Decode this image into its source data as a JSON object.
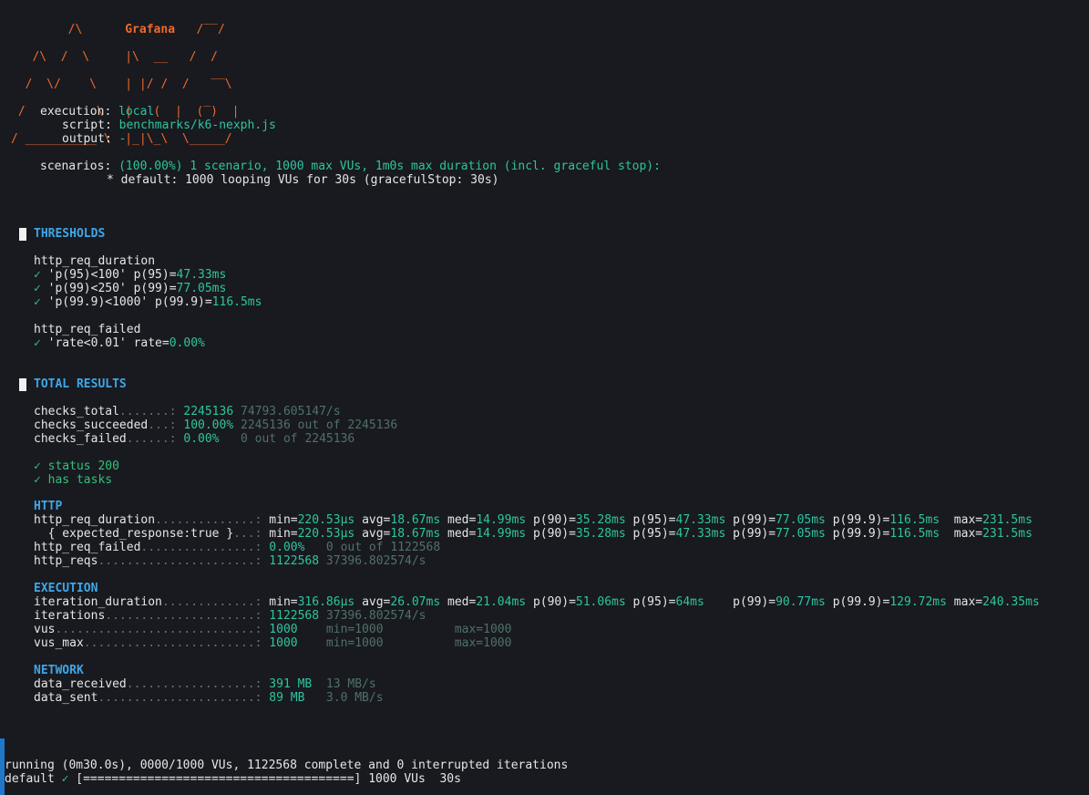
{
  "logo": {
    "art": [
      "        /\\      Grafana   /‾‾/",
      "   /\\  /  \\     |\\  __   /  /",
      "  /  \\/    \\    | |/ /  /   ‾‾\\",
      " /          \\   |   (  |  (‾)  |",
      "/ __________ \\  |_|\\_\\  \\_____/"
    ],
    "brand": "Grafana"
  },
  "info": {
    "execution": {
      "label": "execution:",
      "value": "local"
    },
    "script": {
      "label": "script:",
      "value": "benchmarks/k6-nexph.js"
    },
    "output": {
      "label": "output:",
      "value": "-"
    },
    "scenarios": {
      "label": "scenarios:",
      "value": "(100.00%) 1 scenario, 1000 max VUs, 1m0s max duration (incl. graceful stop):"
    },
    "default_line": "* default: 1000 looping VUs for 30s (gracefulStop: 30s)"
  },
  "thresholds": {
    "title": "THRESHOLDS",
    "duration_metric": "http_req_duration",
    "duration_rules": [
      {
        "rule": "'p(95)<100' p(95)=",
        "value": "47.33ms"
      },
      {
        "rule": "'p(99)<250' p(99)=",
        "value": "77.05ms"
      },
      {
        "rule": "'p(99.9)<1000' p(99.9)=",
        "value": "116.5ms"
      }
    ],
    "failed_metric": "http_req_failed",
    "failed_rules": [
      {
        "rule": "'rate<0.01' rate=",
        "value": "0.00%"
      }
    ],
    "check_glyph": "✓"
  },
  "total": {
    "title": "TOTAL RESULTS",
    "checks": [
      {
        "name": "checks_total",
        "dots": ".......:",
        "value": "2245136",
        "extra": "74793.605147/s"
      },
      {
        "name": "checks_succeeded",
        "dots": "...:",
        "value": "100.00%",
        "extra": "2245136 out of 2245136"
      },
      {
        "name": "checks_failed",
        "dots": "......:",
        "value": "0.00%",
        "extra": "0 out of 2245136"
      }
    ],
    "check_items": [
      "status 200",
      "has tasks"
    ]
  },
  "http": {
    "title": "HTTP",
    "duration": {
      "name": "http_req_duration",
      "dots": "..............:",
      "stats": [
        {
          "k": "min=",
          "v": "220.53µs"
        },
        {
          "k": "avg=",
          "v": "18.67ms"
        },
        {
          "k": "med=",
          "v": "14.99ms"
        },
        {
          "k": "p(90)=",
          "v": "35.28ms"
        },
        {
          "k": "p(95)=",
          "v": "47.33ms"
        },
        {
          "k": "p(99)=",
          "v": "77.05ms"
        },
        {
          "k": "p(99.9)=",
          "v": "116.5ms"
        },
        {
          "k": "max=",
          "v": "231.5ms"
        }
      ]
    },
    "expected": {
      "name": "  { expected_response:true }",
      "dots": "...:",
      "stats": [
        {
          "k": "min=",
          "v": "220.53µs"
        },
        {
          "k": "avg=",
          "v": "18.67ms"
        },
        {
          "k": "med=",
          "v": "14.99ms"
        },
        {
          "k": "p(90)=",
          "v": "35.28ms"
        },
        {
          "k": "p(95)=",
          "v": "47.33ms"
        },
        {
          "k": "p(99)=",
          "v": "77.05ms"
        },
        {
          "k": "p(99.9)=",
          "v": "116.5ms"
        },
        {
          "k": "max=",
          "v": "231.5ms"
        }
      ]
    },
    "failed": {
      "name": "http_req_failed",
      "dots": "................:",
      "value": "0.00%",
      "extra": "0 out of 1122568"
    },
    "reqs": {
      "name": "http_reqs",
      "dots": "......................:",
      "value": "1122568",
      "extra": "37396.802574/s"
    }
  },
  "execution": {
    "title": "EXECUTION",
    "iteration": {
      "name": "iteration_duration",
      "dots": ".............:",
      "stats": [
        {
          "k": "min=",
          "v": "316.86µs"
        },
        {
          "k": "avg=",
          "v": "26.07ms"
        },
        {
          "k": "med=",
          "v": "21.04ms"
        },
        {
          "k": "p(90)=",
          "v": "51.06ms"
        },
        {
          "k": "p(95)=",
          "v": "64ms"
        },
        {
          "k": "p(99)=",
          "v": "90.77ms"
        },
        {
          "k": "p(99.9)=",
          "v": "129.72ms"
        },
        {
          "k": "max=",
          "v": "240.35ms"
        }
      ]
    },
    "iterations": {
      "name": "iterations",
      "dots": ".....................:",
      "value": "1122568",
      "extra": "37396.802574/s"
    },
    "vus": {
      "name": "vus",
      "dots": "............................:",
      "value": "1000",
      "min": "min=1000",
      "max": "max=1000"
    },
    "vus_max": {
      "name": "vus_max",
      "dots": "........................:",
      "value": "1000",
      "min": "min=1000",
      "max": "max=1000"
    }
  },
  "network": {
    "title": "NETWORK",
    "received": {
      "name": "data_received",
      "dots": "..................:",
      "value": "391 MB",
      "extra": "13 MB/s"
    },
    "sent": {
      "name": "data_sent",
      "dots": "......................:",
      "value": "89 MB",
      "extra": "3.0 MB/s"
    }
  },
  "status": {
    "running": "running (0m30.0s), 0000/1000 VUs, 1122568 complete and 0 interrupted iterations",
    "default_label": "default",
    "progress_bar": "[======================================]",
    "progress_tail": "1000 VUs  30s",
    "progress": 1.0
  },
  "colors": {
    "background": "#181a1f",
    "orange": "#ee6a2a",
    "value_green": "#2ec4a0",
    "header_blue": "#3fa6e8",
    "dim": "#51706a",
    "check_green": "#33c07a",
    "side_accent": "#1f78c8"
  }
}
